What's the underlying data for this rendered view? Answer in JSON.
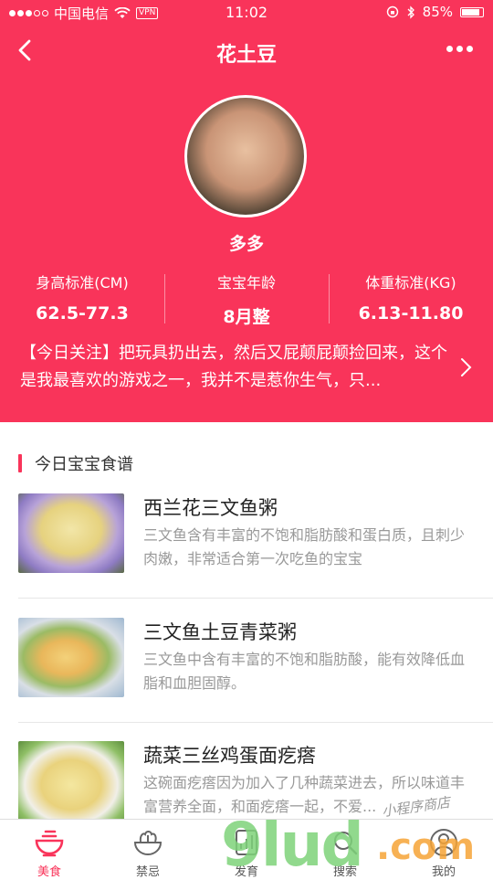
{
  "status_bar": {
    "carrier": "中国电信",
    "vpn": "VPN",
    "time": "11:02",
    "battery": "85%",
    "battery_level": 0.85
  },
  "nav": {
    "title": "花土豆"
  },
  "profile": {
    "name": "多多"
  },
  "stats": [
    {
      "label": "身高标准(CM)",
      "value": "62.5-77.3"
    },
    {
      "label": "宝宝年龄",
      "value": "8月整"
    },
    {
      "label": "体重标准(KG)",
      "value": "6.13-11.80"
    }
  ],
  "notice": {
    "text": "【今日关注】把玩具扔出去，然后又屁颠屁颠捡回来，这个是我最喜欢的游戏之一，我并不是惹你生气，只..."
  },
  "section": {
    "title": "今日宝宝食谱"
  },
  "recipes": [
    {
      "title": "西兰花三文鱼粥",
      "desc": "三文鱼含有丰富的不饱和脂肪酸和蛋白质，且刺少肉嫩，非常适合第一次吃鱼的宝宝"
    },
    {
      "title": "三文鱼土豆青菜粥",
      "desc": "三文鱼中含有丰富的不饱和脂肪酸，能有效降低血脂和血胆固醇。"
    },
    {
      "title": "蔬菜三丝鸡蛋面疙瘩",
      "desc": "这碗面疙瘩因为加入了几种蔬菜进去，所以味道丰富营养全面，和面疙瘩一起，不爱..."
    }
  ],
  "tabs": [
    {
      "label": "美食",
      "icon": "bowl-icon",
      "active": true
    },
    {
      "label": "禁忌",
      "icon": "salad-icon",
      "active": false
    },
    {
      "label": "发育",
      "icon": "growth-icon",
      "active": false
    },
    {
      "label": "搜索",
      "icon": "search-icon",
      "active": false
    },
    {
      "label": "我的",
      "icon": "user-icon",
      "active": false
    }
  ],
  "watermark": {
    "text": "9lud",
    "suffix": ".com",
    "signature": "小程序商店"
  },
  "colors": {
    "accent": "#F9345A"
  }
}
